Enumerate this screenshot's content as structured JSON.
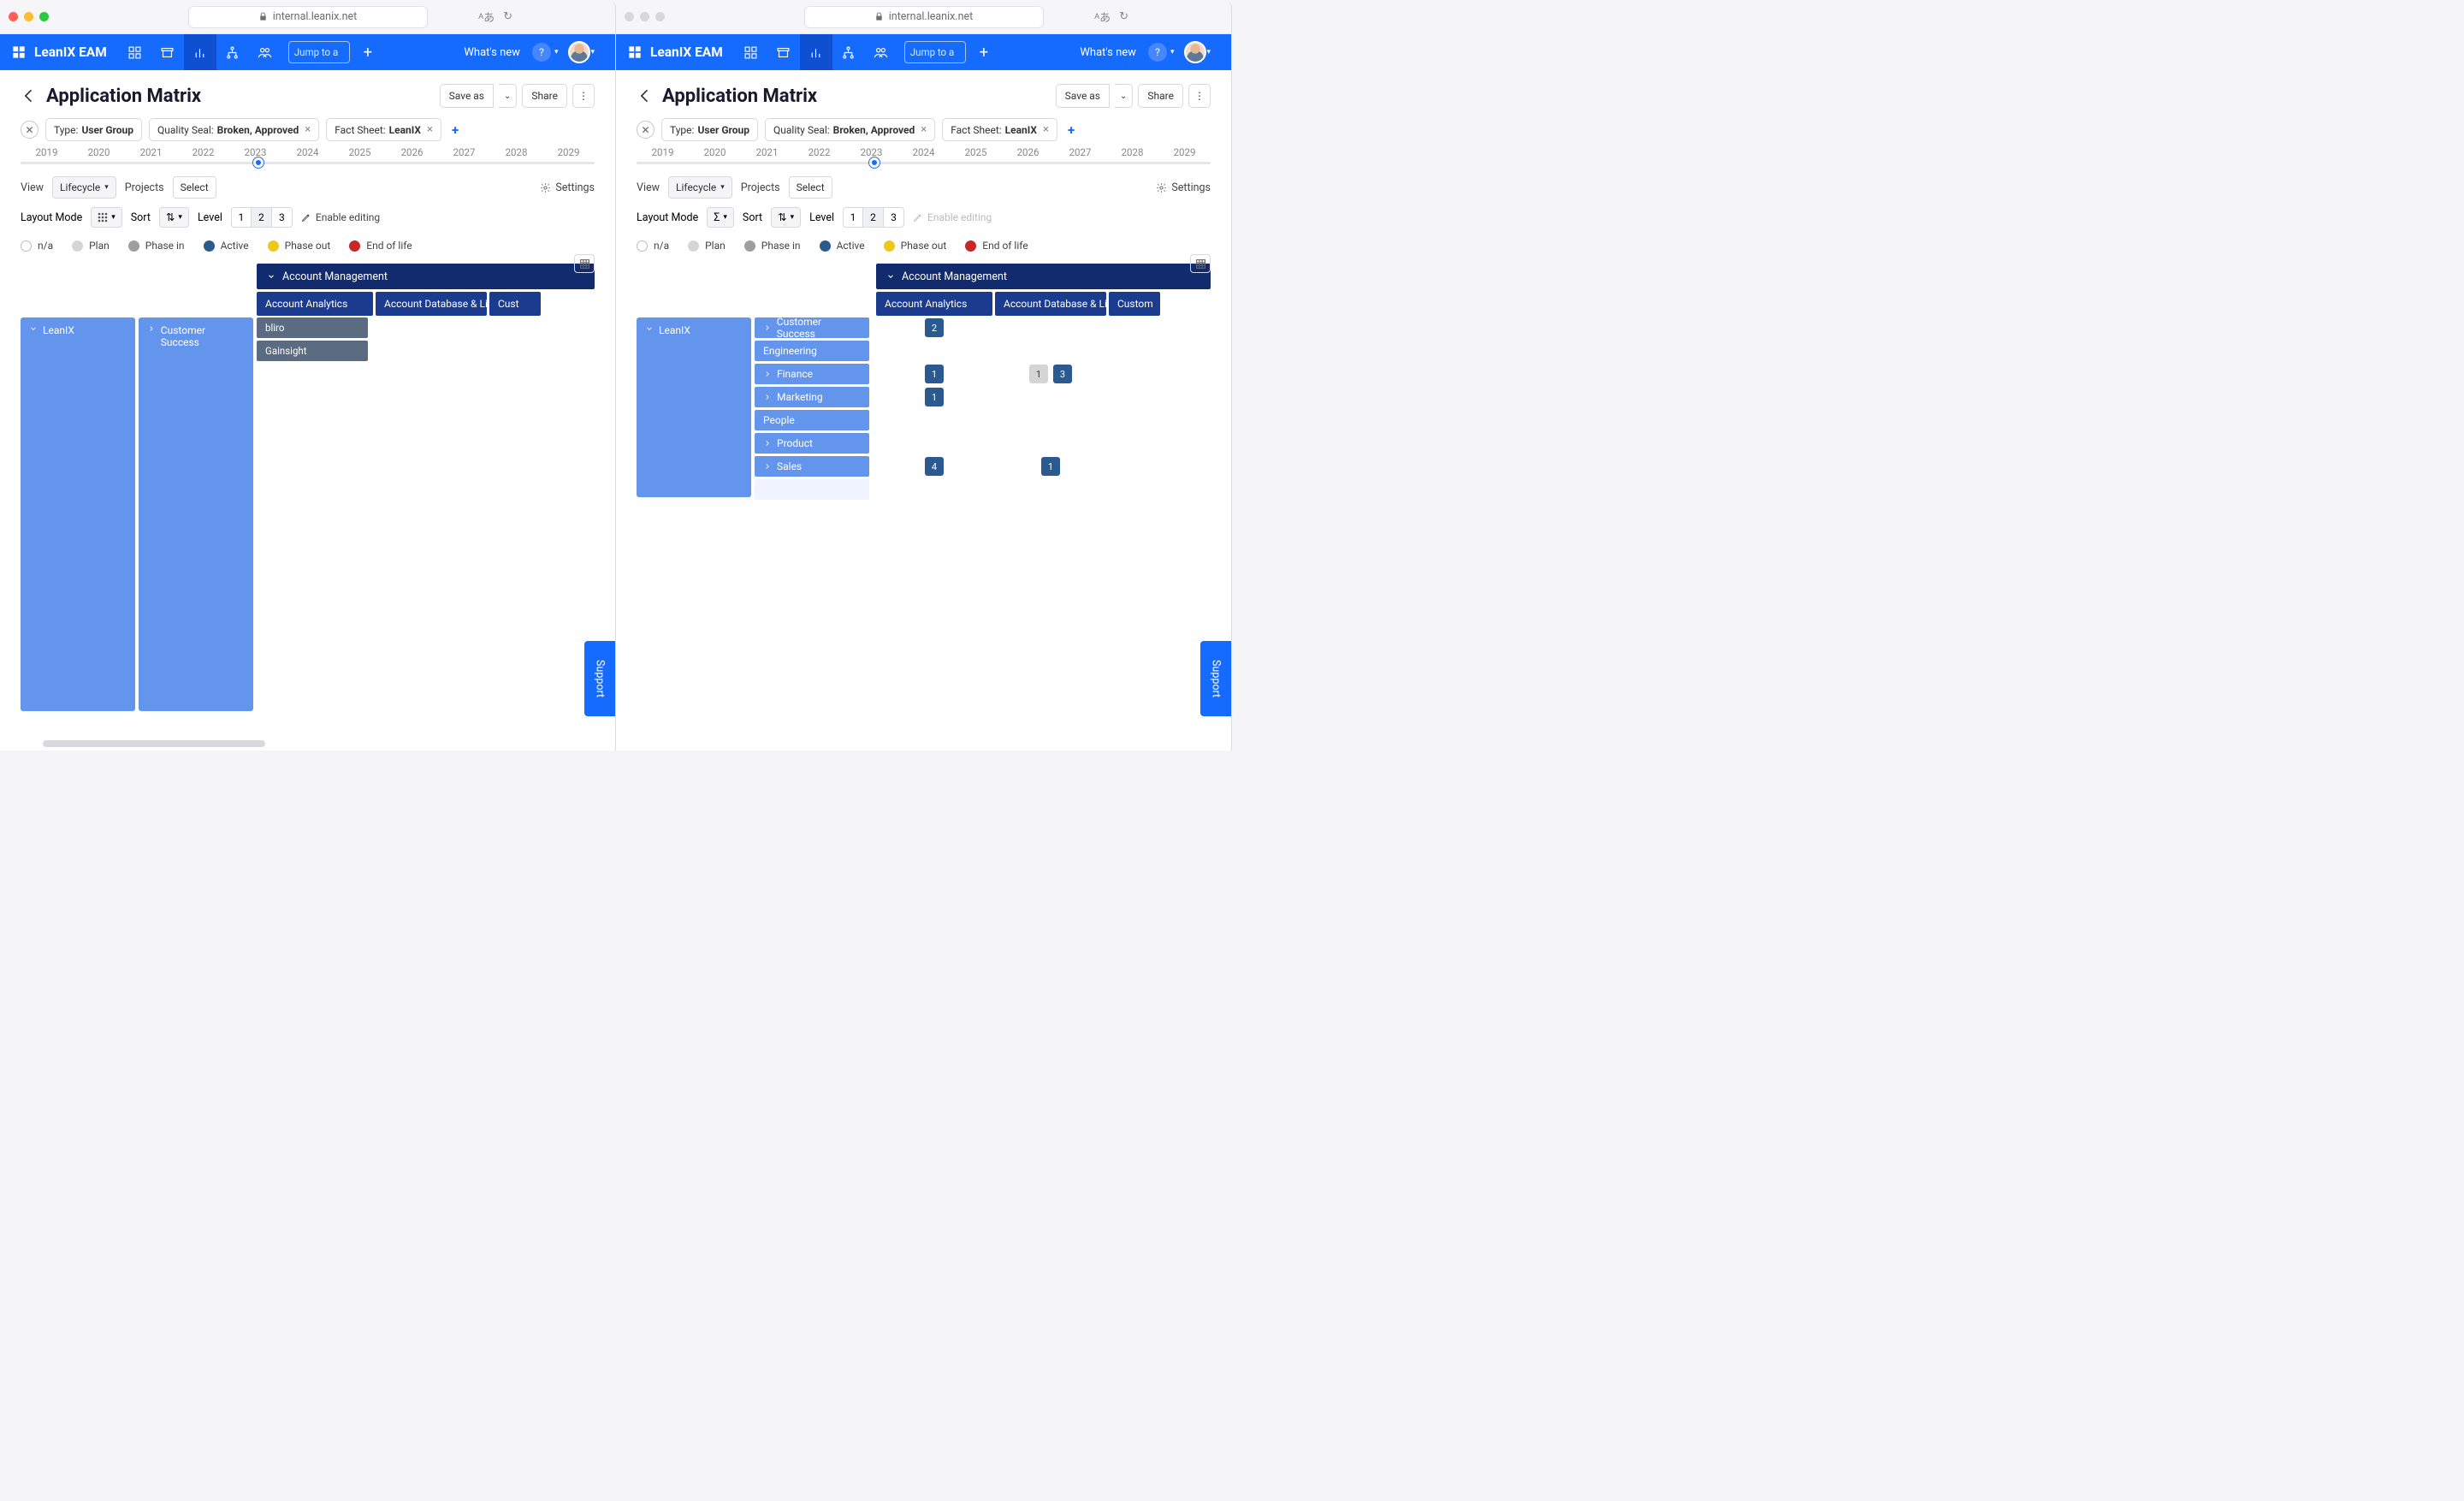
{
  "browser": {
    "url_host": "internal.leanix.net"
  },
  "app": {
    "name": "LeanIX EAM",
    "whats_new": "What's new",
    "jump_placeholder": "Jump to a"
  },
  "page": {
    "title": "Application Matrix",
    "save_as": "Save as",
    "share": "Share"
  },
  "filters": {
    "type_label": "Type:",
    "type_value": "User Group",
    "seal_label": "Quality Seal:",
    "seal_value": "Broken, Approved",
    "fs_label": "Fact Sheet:",
    "fs_value": "LeanIX"
  },
  "timeline": {
    "years": [
      "2019",
      "2020",
      "2021",
      "2022",
      "2023",
      "2024",
      "2025",
      "2026",
      "2027",
      "2028",
      "2029"
    ]
  },
  "view": {
    "label": "View",
    "value": "Lifecycle",
    "projects": "Projects",
    "select": "Select",
    "settings": "Settings"
  },
  "layout": {
    "label": "Layout Mode",
    "sort": "Sort",
    "level": "Level",
    "levels": [
      "1",
      "2",
      "3"
    ],
    "enable_editing": "Enable editing",
    "sigma": "Σ"
  },
  "legend": {
    "na": "n/a",
    "plan": "Plan",
    "phase_in": "Phase in",
    "active": "Active",
    "phase_out": "Phase out",
    "eol": "End of life"
  },
  "matrix_left": {
    "root": "LeanIX",
    "group_header": "Account Management",
    "cols": [
      "Account Analytics",
      "Account Database & Lis...",
      "Cust"
    ],
    "row": "Customer Success",
    "apps": [
      "bliro",
      "Gainsight"
    ]
  },
  "matrix_right": {
    "root": "LeanIX",
    "group_header": "Account Management",
    "cols": [
      "Account Analytics",
      "Account Database & Lis...",
      "Custom"
    ],
    "rows": [
      "Customer Success",
      "Engineering",
      "Finance",
      "Marketing",
      "People",
      "Product",
      "Sales"
    ],
    "counts": {
      "Customer Success": {
        "c1": {
          "v": "2",
          "cls": "dk"
        }
      },
      "Finance": {
        "c1": {
          "v": "1",
          "cls": "dk"
        },
        "c2a": {
          "v": "1",
          "cls": "lt"
        },
        "c2b": {
          "v": "3",
          "cls": "dk"
        }
      },
      "Marketing": {
        "c1": {
          "v": "1",
          "cls": "dk"
        }
      },
      "Sales": {
        "c1": {
          "v": "4",
          "cls": "dk"
        },
        "c2": {
          "v": "1",
          "cls": "dk"
        }
      }
    }
  },
  "support": "Support"
}
